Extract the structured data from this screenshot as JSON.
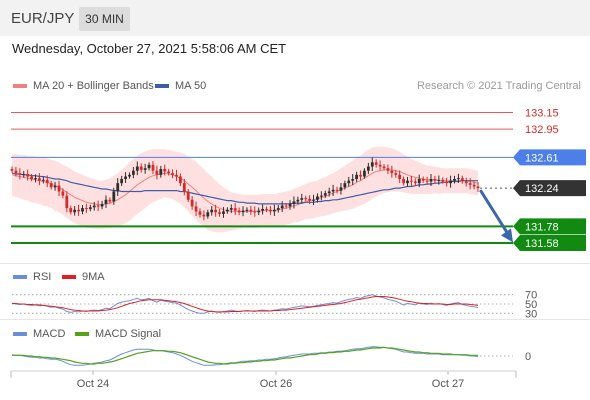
{
  "header": {
    "symbol": "EUR/JPY",
    "interval": "30 MIN"
  },
  "timestamp": "Wednesday, October 27, 2021 5:58:06 AM CET",
  "credit": "Research © 2021 Trading Central",
  "colors": {
    "resistance": "#e8585a",
    "current": "#4d7fe8",
    "support": "#128a12",
    "ma50": "#3c5ea8",
    "bollinger": "#ffd6d6",
    "ma20": "#f08080",
    "rsi": "#6b8fd6",
    "rsi_ma": "#e02020",
    "macd": "#6b8fd6",
    "macd_signal": "#54a21a",
    "up_candle": "#2e2e2e",
    "down_candle": "#d42a2a",
    "arrow": "#3a6aa6"
  },
  "chart_data": [
    {
      "type": "candlestick",
      "panel": "price",
      "ylim": [
        131.4,
        133.3
      ],
      "legend": [
        {
          "name": "MA 20 + Bollinger Bands",
          "color": "#f08080"
        },
        {
          "name": "MA 50",
          "color": "#3c5ea8"
        }
      ],
      "levels": [
        {
          "value": 133.15,
          "label": "133.15",
          "kind": "resistance"
        },
        {
          "value": 132.95,
          "label": "132.95",
          "kind": "resistance"
        },
        {
          "value": 132.61,
          "label": "132.61",
          "kind": "current"
        },
        {
          "value": 132.24,
          "label": "132.24",
          "kind": "last"
        },
        {
          "value": 131.78,
          "label": "131.78",
          "kind": "support"
        },
        {
          "value": 131.58,
          "label": "131.58",
          "kind": "support"
        }
      ],
      "x_ticks": [
        "Oct 24",
        "Oct 26",
        "Oct 27"
      ],
      "close": [
        132.45,
        132.42,
        132.4,
        132.41,
        132.38,
        132.35,
        132.36,
        132.33,
        132.34,
        132.3,
        132.25,
        132.27,
        132.2,
        132.15,
        132.0,
        131.95,
        131.98,
        131.96,
        132.0,
        131.99,
        132.01,
        132.03,
        132.02,
        132.05,
        132.1,
        132.08,
        132.2,
        132.3,
        132.35,
        132.38,
        132.4,
        132.45,
        132.5,
        132.46,
        132.48,
        132.52,
        132.45,
        132.4,
        132.47,
        132.44,
        132.42,
        132.4,
        132.38,
        132.3,
        132.2,
        132.1,
        132.02,
        131.96,
        131.92,
        131.9,
        131.95,
        131.98,
        131.95,
        131.93,
        131.96,
        131.98,
        132.0,
        131.97,
        131.95,
        131.97,
        131.98,
        131.96,
        131.95,
        131.97,
        131.99,
        131.98,
        131.96,
        131.98,
        132.0,
        132.03,
        132.02,
        132.05,
        132.08,
        132.1,
        132.12,
        132.11,
        132.09,
        132.1,
        132.14,
        132.15,
        132.18,
        132.2,
        132.22,
        132.21,
        132.25,
        132.3,
        132.33,
        132.35,
        132.4,
        132.38,
        132.45,
        132.5,
        132.55,
        132.52,
        132.5,
        132.48,
        132.45,
        132.42,
        132.4,
        132.35,
        132.3,
        132.33,
        132.32,
        132.3,
        132.35,
        132.33,
        132.32,
        132.35,
        132.33,
        132.34,
        132.32,
        132.3,
        132.33,
        132.35,
        132.36,
        132.32,
        132.3,
        132.28,
        132.26,
        132.24
      ],
      "ma20": [
        132.4,
        132.39,
        132.38,
        132.37,
        132.36,
        132.35,
        132.34,
        132.33,
        132.32,
        132.31,
        132.29,
        132.27,
        132.25,
        132.22,
        132.19,
        132.16,
        132.13,
        132.11,
        132.09,
        132.07,
        132.06,
        132.05,
        132.04,
        132.04,
        132.05,
        132.06,
        132.08,
        132.1,
        132.13,
        132.16,
        132.2,
        132.24,
        132.28,
        132.31,
        132.34,
        132.37,
        132.39,
        132.4,
        132.41,
        132.42,
        132.41,
        132.4,
        132.38,
        132.36,
        132.33,
        132.29,
        132.25,
        132.21,
        132.16,
        132.12,
        132.08,
        132.05,
        132.02,
        132.0,
        131.98,
        131.97,
        131.96,
        131.96,
        131.96,
        131.96,
        131.96,
        131.96,
        131.96,
        131.96,
        131.97,
        131.97,
        131.97,
        131.97,
        131.98,
        131.99,
        132.0,
        132.01,
        132.03,
        132.04,
        132.06,
        132.08,
        132.09,
        132.1,
        132.11,
        132.13,
        132.14,
        132.16,
        132.18,
        132.2,
        132.22,
        132.24,
        132.26,
        132.28,
        132.31,
        132.33,
        132.36,
        132.39,
        132.42,
        132.44,
        132.45,
        132.46,
        132.46,
        132.46,
        132.45,
        132.44,
        132.42,
        132.4,
        132.38,
        132.37,
        132.36,
        132.35,
        132.34,
        132.34,
        132.34,
        132.33,
        132.33,
        132.33,
        132.33,
        132.33,
        132.33,
        132.33,
        132.33,
        132.32,
        132.31,
        132.3
      ],
      "ma50": [
        132.42,
        132.41,
        132.41,
        132.4,
        132.4,
        132.39,
        132.39,
        132.38,
        132.38,
        132.37,
        132.36,
        132.35,
        132.35,
        132.34,
        132.33,
        132.31,
        132.3,
        132.29,
        132.28,
        132.27,
        132.26,
        132.25,
        132.24,
        132.23,
        132.23,
        132.22,
        132.21,
        132.21,
        132.2,
        132.2,
        132.2,
        132.2,
        132.2,
        132.2,
        132.21,
        132.21,
        132.21,
        132.21,
        132.21,
        132.21,
        132.21,
        132.21,
        132.21,
        132.2,
        132.2,
        132.19,
        132.18,
        132.17,
        132.16,
        132.15,
        132.14,
        132.13,
        132.12,
        132.11,
        132.1,
        132.09,
        132.09,
        132.08,
        132.07,
        132.07,
        132.06,
        132.06,
        132.06,
        132.05,
        132.05,
        132.05,
        132.05,
        132.05,
        132.05,
        132.05,
        132.05,
        132.05,
        132.06,
        132.06,
        132.06,
        132.07,
        132.07,
        132.07,
        132.08,
        132.08,
        132.09,
        132.09,
        132.1,
        132.1,
        132.11,
        132.12,
        132.13,
        132.14,
        132.15,
        132.16,
        132.17,
        132.18,
        132.19,
        132.2,
        132.21,
        132.22,
        132.22,
        132.23,
        132.24,
        132.24,
        132.25,
        132.26,
        132.26,
        132.27,
        132.28,
        132.28,
        132.29,
        132.29,
        132.3,
        132.3,
        132.31,
        132.31,
        132.32,
        132.32,
        132.32,
        132.33,
        132.33,
        132.33,
        132.33,
        132.33
      ],
      "bb_width": [
        0.25,
        0.26,
        0.26,
        0.27,
        0.27,
        0.28,
        0.28,
        0.28,
        0.29,
        0.29,
        0.29,
        0.3,
        0.3,
        0.3,
        0.31,
        0.31,
        0.31,
        0.31,
        0.31,
        0.31,
        0.3,
        0.3,
        0.29,
        0.29,
        0.29,
        0.3,
        0.31,
        0.32,
        0.33,
        0.34,
        0.35,
        0.35,
        0.35,
        0.35,
        0.34,
        0.33,
        0.32,
        0.31,
        0.3,
        0.29,
        0.29,
        0.29,
        0.3,
        0.31,
        0.32,
        0.33,
        0.34,
        0.35,
        0.35,
        0.35,
        0.34,
        0.33,
        0.31,
        0.29,
        0.27,
        0.25,
        0.23,
        0.22,
        0.21,
        0.2,
        0.2,
        0.2,
        0.2,
        0.2,
        0.2,
        0.2,
        0.2,
        0.2,
        0.2,
        0.2,
        0.2,
        0.2,
        0.2,
        0.21,
        0.21,
        0.21,
        0.22,
        0.22,
        0.22,
        0.23,
        0.23,
        0.24,
        0.24,
        0.25,
        0.26,
        0.27,
        0.28,
        0.29,
        0.3,
        0.3,
        0.31,
        0.31,
        0.31,
        0.3,
        0.29,
        0.28,
        0.27,
        0.26,
        0.25,
        0.24,
        0.23,
        0.22,
        0.21,
        0.2,
        0.19,
        0.18,
        0.17,
        0.17,
        0.16,
        0.16,
        0.15,
        0.15,
        0.15,
        0.15,
        0.15,
        0.15,
        0.15,
        0.15,
        0.15,
        0.15
      ],
      "forecast_target": 131.78
    },
    {
      "type": "line",
      "panel": "rsi",
      "ylim": [
        20,
        80
      ],
      "legend": [
        {
          "name": "RSI",
          "color": "#6b8fd6"
        },
        {
          "name": "9MA",
          "color": "#e02020"
        }
      ],
      "levels": [
        {
          "value": 70,
          "label": "70"
        },
        {
          "value": 50,
          "label": "50"
        },
        {
          "value": 30,
          "label": "30"
        }
      ],
      "rsi": [
        52,
        50,
        49,
        50,
        48,
        47,
        48,
        46,
        47,
        45,
        43,
        44,
        41,
        39,
        34,
        32,
        34,
        33,
        35,
        34,
        36,
        37,
        36,
        38,
        41,
        40,
        46,
        51,
        54,
        56,
        57,
        60,
        62,
        59,
        60,
        62,
        57,
        54,
        58,
        56,
        55,
        53,
        52,
        48,
        43,
        38,
        35,
        32,
        30,
        30,
        33,
        35,
        33,
        32,
        34,
        35,
        37,
        35,
        34,
        35,
        36,
        35,
        34,
        36,
        37,
        36,
        35,
        37,
        38,
        40,
        39,
        41,
        43,
        44,
        46,
        45,
        44,
        45,
        47,
        48,
        50,
        51,
        53,
        52,
        55,
        58,
        60,
        61,
        64,
        62,
        66,
        68,
        70,
        67,
        65,
        63,
        60,
        58,
        56,
        52,
        48,
        51,
        50,
        48,
        52,
        50,
        49,
        52,
        50,
        51,
        49,
        47,
        50,
        52,
        53,
        49,
        47,
        45,
        44,
        42
      ],
      "rsi_ma": [
        51,
        51,
        50,
        50,
        49,
        49,
        48,
        48,
        47,
        46,
        45,
        44,
        43,
        42,
        40,
        38,
        37,
        36,
        35,
        35,
        35,
        35,
        35,
        36,
        37,
        38,
        40,
        42,
        45,
        48,
        51,
        53,
        55,
        57,
        58,
        59,
        59,
        59,
        59,
        58,
        57,
        56,
        55,
        53,
        51,
        48,
        45,
        42,
        39,
        37,
        35,
        34,
        33,
        33,
        33,
        33,
        34,
        34,
        34,
        35,
        35,
        35,
        35,
        35,
        35,
        35,
        35,
        36,
        36,
        37,
        37,
        38,
        39,
        40,
        41,
        42,
        43,
        44,
        45,
        46,
        47,
        48,
        49,
        50,
        51,
        53,
        55,
        57,
        59,
        60,
        62,
        63,
        65,
        66,
        66,
        66,
        65,
        64,
        62,
        60,
        58,
        56,
        55,
        53,
        52,
        51,
        51,
        50,
        50,
        50,
        50,
        49,
        49,
        50,
        50,
        50,
        50,
        49,
        48,
        47
      ]
    },
    {
      "type": "line",
      "panel": "macd",
      "ylim": [
        -0.3,
        0.3
      ],
      "legend": [
        {
          "name": "MACD",
          "color": "#6b8fd6"
        },
        {
          "name": "MACD Signal",
          "color": "#54a21a"
        }
      ],
      "levels": [
        {
          "value": 0,
          "label": "0"
        }
      ],
      "macd": [
        0.02,
        0.01,
        0.01,
        0.0,
        -0.01,
        -0.02,
        -0.02,
        -0.03,
        -0.03,
        -0.04,
        -0.05,
        -0.05,
        -0.06,
        -0.08,
        -0.11,
        -0.13,
        -0.14,
        -0.14,
        -0.14,
        -0.13,
        -0.12,
        -0.11,
        -0.1,
        -0.09,
        -0.07,
        -0.06,
        -0.03,
        0.0,
        0.03,
        0.05,
        0.07,
        0.09,
        0.1,
        0.1,
        0.1,
        0.1,
        0.09,
        0.08,
        0.08,
        0.07,
        0.06,
        0.05,
        0.03,
        0.01,
        -0.02,
        -0.05,
        -0.08,
        -0.1,
        -0.12,
        -0.14,
        -0.14,
        -0.14,
        -0.13,
        -0.13,
        -0.12,
        -0.11,
        -0.1,
        -0.1,
        -0.09,
        -0.08,
        -0.08,
        -0.07,
        -0.07,
        -0.06,
        -0.06,
        -0.05,
        -0.05,
        -0.04,
        -0.03,
        -0.02,
        -0.01,
        0.0,
        0.01,
        0.02,
        0.03,
        0.03,
        0.03,
        0.04,
        0.04,
        0.05,
        0.05,
        0.06,
        0.06,
        0.07,
        0.07,
        0.08,
        0.09,
        0.1,
        0.11,
        0.11,
        0.12,
        0.13,
        0.14,
        0.14,
        0.13,
        0.13,
        0.12,
        0.11,
        0.1,
        0.08,
        0.06,
        0.06,
        0.05,
        0.04,
        0.04,
        0.04,
        0.03,
        0.03,
        0.03,
        0.03,
        0.02,
        0.02,
        0.02,
        0.02,
        0.02,
        0.01,
        0.01,
        0.0,
        0.0,
        -0.01
      ],
      "signal": [
        0.01,
        0.01,
        0.01,
        0.01,
        0.0,
        0.0,
        -0.01,
        -0.01,
        -0.02,
        -0.02,
        -0.03,
        -0.03,
        -0.04,
        -0.05,
        -0.06,
        -0.07,
        -0.09,
        -0.1,
        -0.11,
        -0.11,
        -0.12,
        -0.12,
        -0.11,
        -0.11,
        -0.1,
        -0.09,
        -0.08,
        -0.06,
        -0.04,
        -0.02,
        0.0,
        0.02,
        0.04,
        0.05,
        0.06,
        0.07,
        0.08,
        0.08,
        0.08,
        0.08,
        0.07,
        0.07,
        0.06,
        0.05,
        0.03,
        0.01,
        -0.01,
        -0.03,
        -0.05,
        -0.07,
        -0.09,
        -0.1,
        -0.11,
        -0.11,
        -0.12,
        -0.12,
        -0.11,
        -0.11,
        -0.1,
        -0.1,
        -0.09,
        -0.09,
        -0.08,
        -0.08,
        -0.07,
        -0.07,
        -0.06,
        -0.06,
        -0.05,
        -0.04,
        -0.03,
        -0.03,
        -0.02,
        -0.01,
        0.0,
        0.01,
        0.02,
        0.02,
        0.03,
        0.04,
        0.04,
        0.05,
        0.05,
        0.06,
        0.06,
        0.07,
        0.07,
        0.08,
        0.09,
        0.09,
        0.1,
        0.11,
        0.12,
        0.12,
        0.12,
        0.13,
        0.12,
        0.12,
        0.11,
        0.1,
        0.09,
        0.08,
        0.07,
        0.06,
        0.06,
        0.05,
        0.05,
        0.04,
        0.04,
        0.04,
        0.03,
        0.03,
        0.03,
        0.02,
        0.02,
        0.02,
        0.02,
        0.01,
        0.01,
        0.01
      ]
    }
  ]
}
